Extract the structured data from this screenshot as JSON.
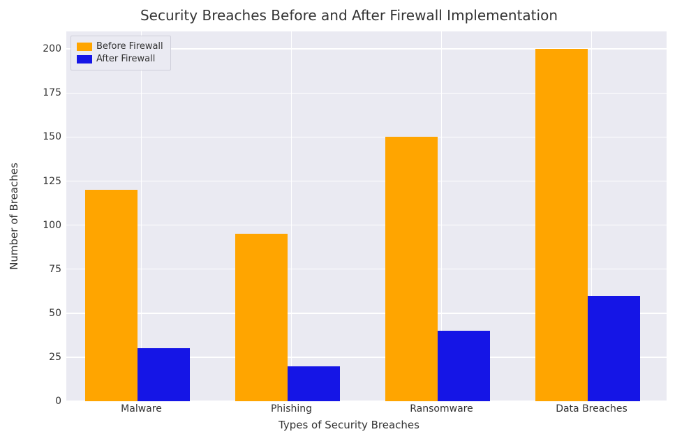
{
  "chart_data": {
    "type": "bar",
    "title": "Security Breaches Before and After Firewall Implementation",
    "xlabel": "Types of Security Breaches",
    "ylabel": "Number of Breaches",
    "categories": [
      "Malware",
      "Phishing",
      "Ransomware",
      "Data Breaches"
    ],
    "series": [
      {
        "name": "Before Firewall",
        "color": "#ffa500",
        "values": [
          120,
          95,
          150,
          200
        ]
      },
      {
        "name": "After Firewall",
        "color": "#1515e6",
        "values": [
          30,
          20,
          40,
          60
        ]
      }
    ],
    "yticks": [
      0,
      25,
      50,
      75,
      100,
      125,
      150,
      175,
      200
    ],
    "ylim": [
      0,
      210
    ],
    "legend_position": "upper-left",
    "grid": true
  }
}
